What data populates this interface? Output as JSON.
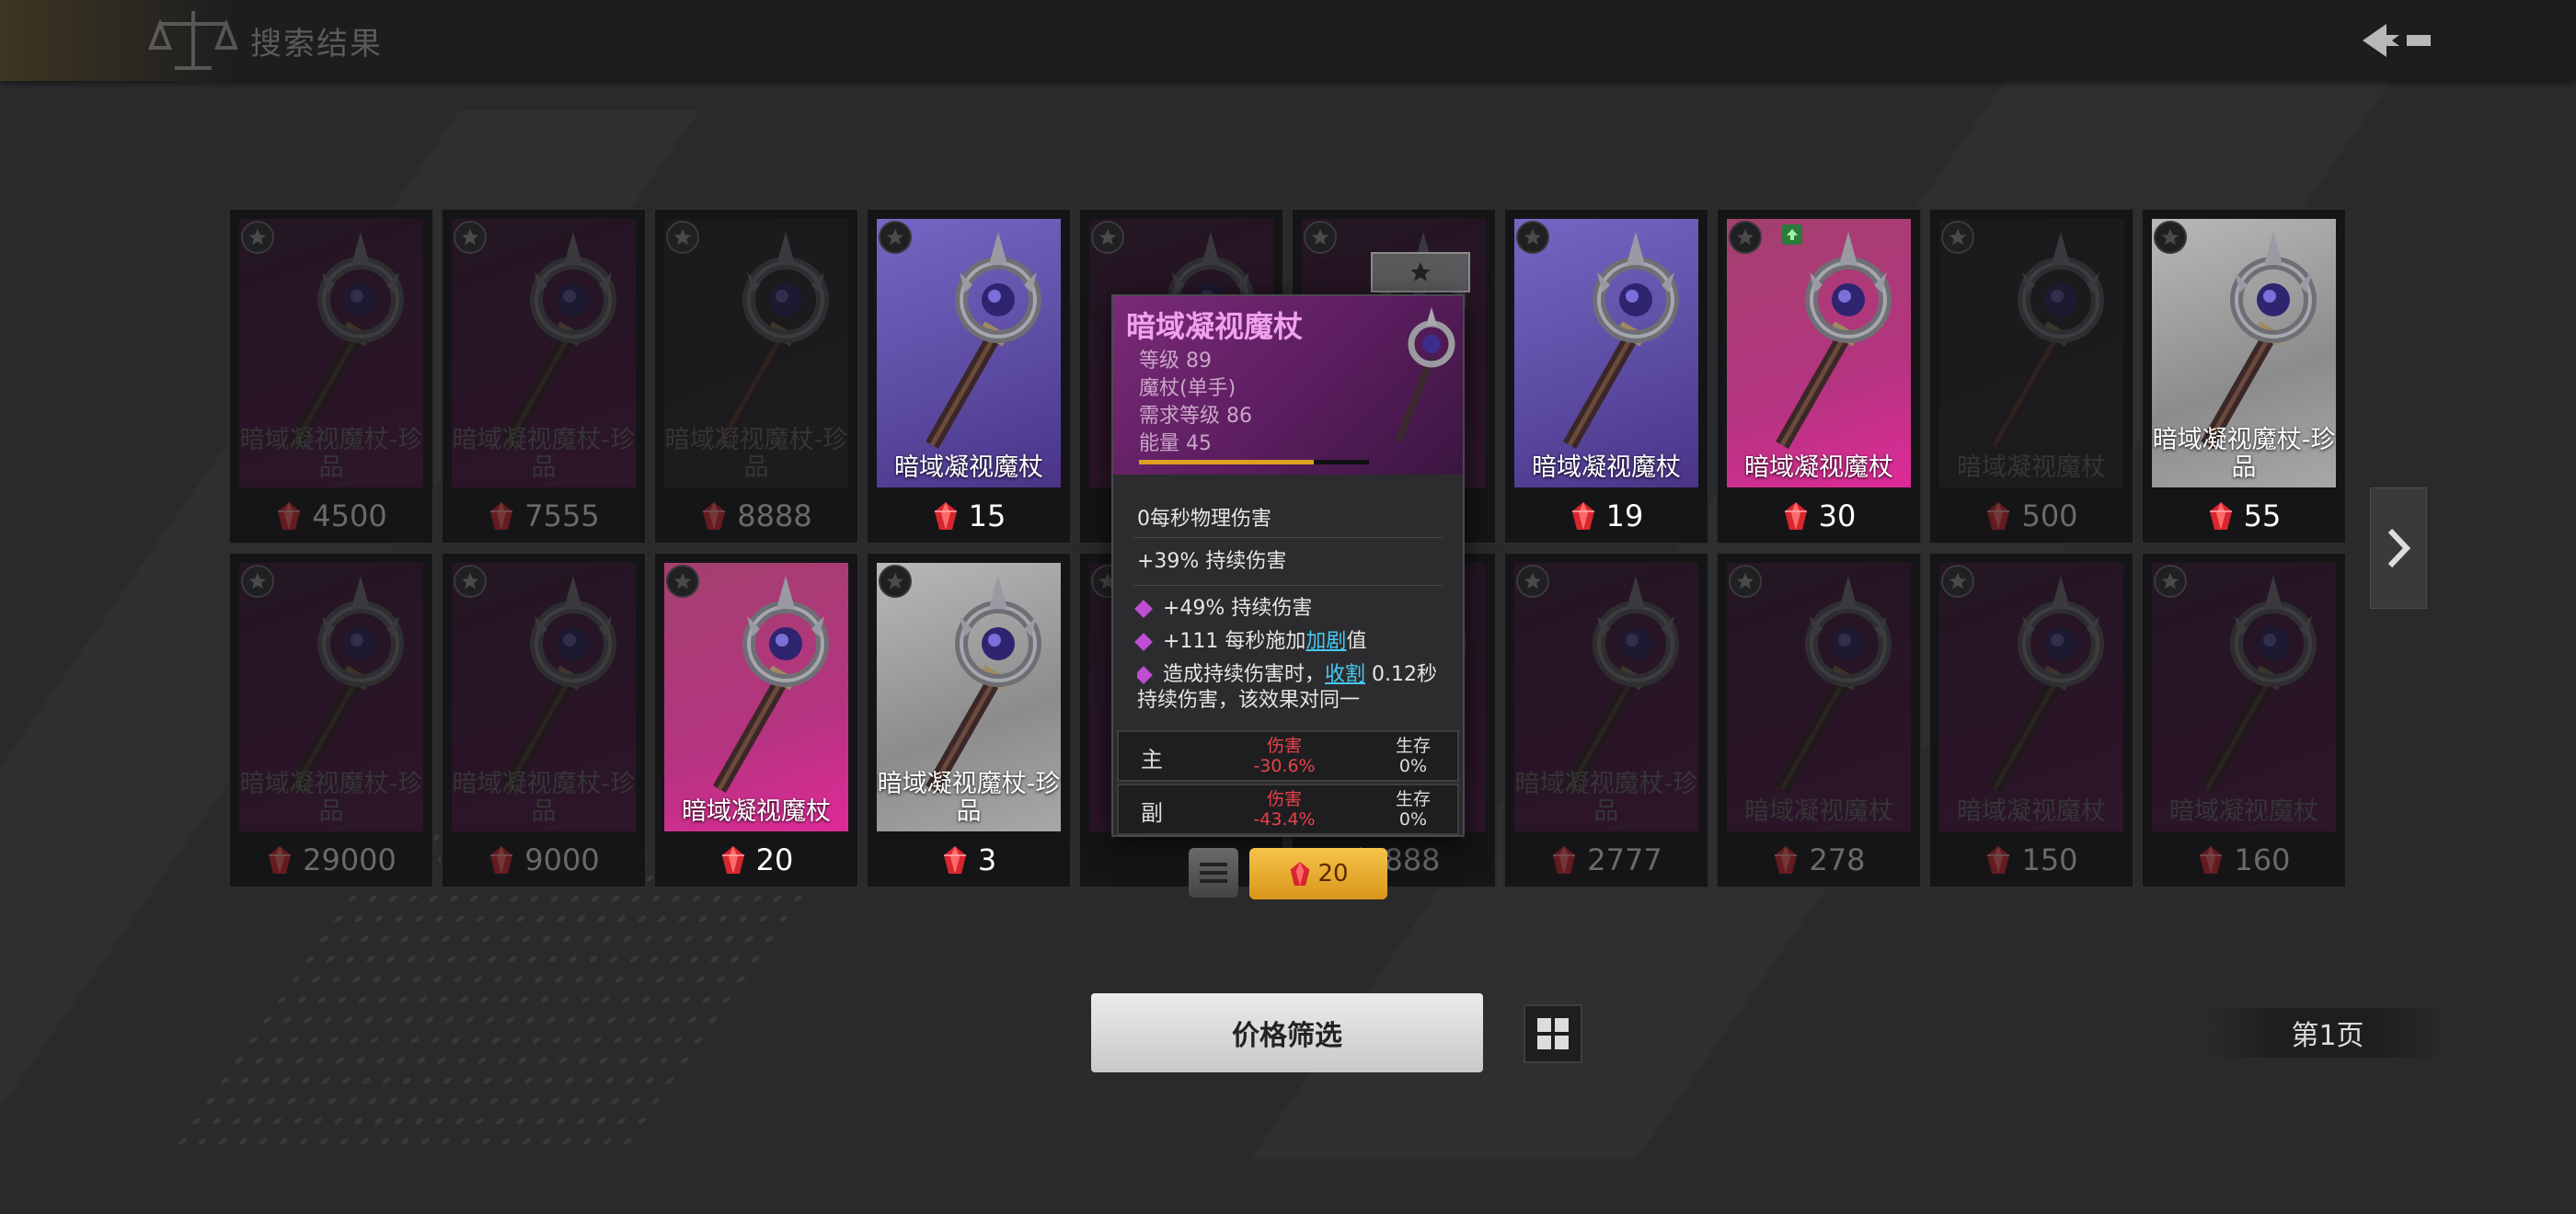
{
  "header": {
    "title": "搜索结果"
  },
  "colors": {
    "purple": "#6a57b0",
    "pink": "#d33a9c",
    "dark_pink": "#5e1450",
    "gray": "#2e2e30",
    "white": "#cfcfcf"
  },
  "cards": [
    {
      "name": "暗域凝视魔杖-珍品",
      "price": "4500",
      "style": "dark_pink",
      "dim": true
    },
    {
      "name": "暗域凝视魔杖-珍品",
      "price": "7555",
      "style": "dark_pink",
      "dim": true
    },
    {
      "name": "暗域凝视魔杖-珍品",
      "price": "8888",
      "style": "gray",
      "dim": true
    },
    {
      "name": "暗域凝视魔杖",
      "price": "15",
      "style": "purple",
      "dim": false
    },
    {
      "name": "",
      "price": "",
      "style": "dark_pink",
      "dim": true
    },
    {
      "name": "",
      "price": "",
      "style": "dark_pink",
      "dim": true
    },
    {
      "name": "暗域凝视魔杖",
      "price": "19",
      "style": "purple",
      "dim": false
    },
    {
      "name": "暗域凝视魔杖",
      "price": "30",
      "style": "pink",
      "dim": false,
      "upgrade": true
    },
    {
      "name": "暗域凝视魔杖",
      "price": "500",
      "style": "gray",
      "dim": true
    },
    {
      "name": "暗域凝视魔杖-珍品",
      "price": "55",
      "style": "white",
      "dim": false
    },
    {
      "name": "暗域凝视魔杖-珍品",
      "price": "29000",
      "style": "dark_pink",
      "dim": true
    },
    {
      "name": "暗域凝视魔杖-珍品",
      "price": "9000",
      "style": "dark_pink",
      "dim": true
    },
    {
      "name": "暗域凝视魔杖",
      "price": "20",
      "style": "pink",
      "dim": false
    },
    {
      "name": "暗域凝视魔杖-珍品",
      "price": "3",
      "style": "white",
      "dim": false
    },
    {
      "name": "",
      "price": "",
      "style": "dark_pink",
      "dim": true
    },
    {
      "name": "",
      "price": "888",
      "style": "dark_pink",
      "dim": true
    },
    {
      "name": "暗域凝视魔杖-珍品",
      "price": "2777",
      "style": "dark_pink",
      "dim": true
    },
    {
      "name": "暗域凝视魔杖",
      "price": "278",
      "style": "dark_pink",
      "dim": true
    },
    {
      "name": "暗域凝视魔杖",
      "price": "150",
      "style": "dark_pink",
      "dim": true
    },
    {
      "name": "暗域凝视魔杖",
      "price": "160",
      "style": "dark_pink",
      "dim": true
    }
  ],
  "tooltip": {
    "title": "暗域凝视魔杖",
    "level": "等级 89",
    "type": "魔杖(单手)",
    "req_level": "需求等级 86",
    "energy": "能量 45",
    "energy_fill": 0.76,
    "stat1": "0每秒物理伤害",
    "stat2": "+39% 持续伤害",
    "mod1": "+49% 持续伤害",
    "mod2_pre": "+111 每秒施加",
    "mod2_link": "加剧",
    "mod2_post": "值",
    "mod3_pre": "造成持续伤害时，",
    "mod3_link": "收割",
    "mod3_post": " 0.12秒持续伤害，该效果对同一",
    "compare": [
      {
        "slot": "主",
        "dmg_label": "伤害",
        "dmg": "-30.6%",
        "surv_label": "生存",
        "surv": "0%"
      },
      {
        "slot": "副",
        "dmg_label": "伤害",
        "dmg": "-43.4%",
        "surv_label": "生存",
        "surv": "0%"
      }
    ],
    "buy_price": "20"
  },
  "bottom": {
    "filter_label": "价格筛选",
    "page_label": "第1页"
  }
}
